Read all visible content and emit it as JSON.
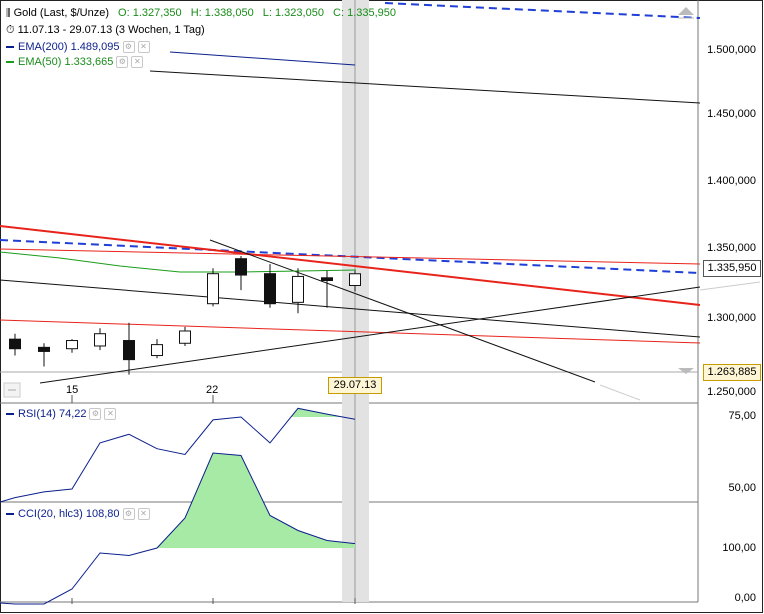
{
  "header": {
    "instrument": "Gold (Last, $/Unze)",
    "open": "O: 1.327,350",
    "high": "H: 1.338,050",
    "low": "L: 1.323,050",
    "close": "C: 1.335,950",
    "period": "11.07.13 - 29.07.13 (3 Wochen, 1 Tag)",
    "ema200": "EMA(200)  1.489,095",
    "ema50": "EMA(50)  1.333,665"
  },
  "colors": {
    "ema200": "#0b1f8c",
    "ema50": "#1a9c1a",
    "red": "#e8231a",
    "blue_dash": "#1f3fd6",
    "fill": "#a6eaa6"
  },
  "price_axis_labels": [
    "1.500,000",
    "1.450,000",
    "1.400,000",
    "1.350,000",
    "1.300,000",
    "1.250,000"
  ],
  "current_price_box": "1.335,950",
  "level_box": "1.263,885",
  "date_box": "29.07.13",
  "x_axis_labels": [
    "15",
    "22"
  ],
  "rsi": {
    "label": "RSI(14)  74,22",
    "axis_labels": [
      "75,00",
      "50,00"
    ]
  },
  "cci": {
    "label": "CCI(20, hlc3)  108,80",
    "axis_labels": [
      "100,00",
      "0,00"
    ]
  },
  "chart_data": [
    {
      "type": "candlestick",
      "title": "Gold (Last, $/Unze)",
      "x": [
        "11.07.13",
        "12.07.13",
        "15.07.13",
        "16.07.13",
        "17.07.13",
        "18.07.13",
        "19.07.13",
        "22.07.13",
        "23.07.13",
        "24.07.13",
        "25.07.13",
        "26.07.13",
        "29.07.13"
      ],
      "open": [
        1288,
        1282,
        1281,
        1283,
        1287,
        1276,
        1285,
        1314,
        1347,
        1336,
        1315,
        1333,
        1327.35
      ],
      "high": [
        1292,
        1285,
        1288,
        1296,
        1300,
        1288,
        1297,
        1340,
        1349,
        1343,
        1340,
        1338,
        1338.05
      ],
      "low": [
        1276,
        1268,
        1278,
        1280,
        1262,
        1274,
        1283,
        1312,
        1324,
        1311,
        1307,
        1311,
        1323.05
      ],
      "close": [
        1281,
        1279,
        1287,
        1292,
        1273,
        1284,
        1294,
        1336,
        1335,
        1314,
        1334,
        1331,
        1335.95
      ],
      "y_axis_ticks": [
        1250,
        1300,
        1350,
        1400,
        1450,
        1500
      ],
      "ylim": [
        1238,
        1540
      ]
    },
    {
      "type": "line",
      "title": "RSI(14)",
      "x": [
        "11.07.13",
        "12.07.13",
        "15.07.13",
        "16.07.13",
        "17.07.13",
        "18.07.13",
        "19.07.13",
        "22.07.13",
        "23.07.13",
        "24.07.13",
        "25.07.13",
        "26.07.13",
        "29.07.13"
      ],
      "values": [
        47,
        49,
        50,
        66,
        69,
        64,
        62,
        74,
        75,
        66,
        78,
        76,
        74.22
      ],
      "y_axis_ticks": [
        50,
        75
      ],
      "ylim": [
        44,
        79
      ]
    },
    {
      "type": "line",
      "title": "CCI(20, hlc3)",
      "x": [
        "11.07.13",
        "12.07.13",
        "15.07.13",
        "16.07.13",
        "17.07.13",
        "18.07.13",
        "19.07.13",
        "22.07.13",
        "23.07.13",
        "24.07.13",
        "25.07.13",
        "26.07.13",
        "29.07.13"
      ],
      "values": [
        -12,
        -12,
        18,
        90,
        85,
        100,
        160,
        290,
        285,
        165,
        135,
        115,
        108.8
      ],
      "y_axis_ticks": [
        0,
        100
      ],
      "ylim": [
        -60,
        330
      ]
    }
  ]
}
